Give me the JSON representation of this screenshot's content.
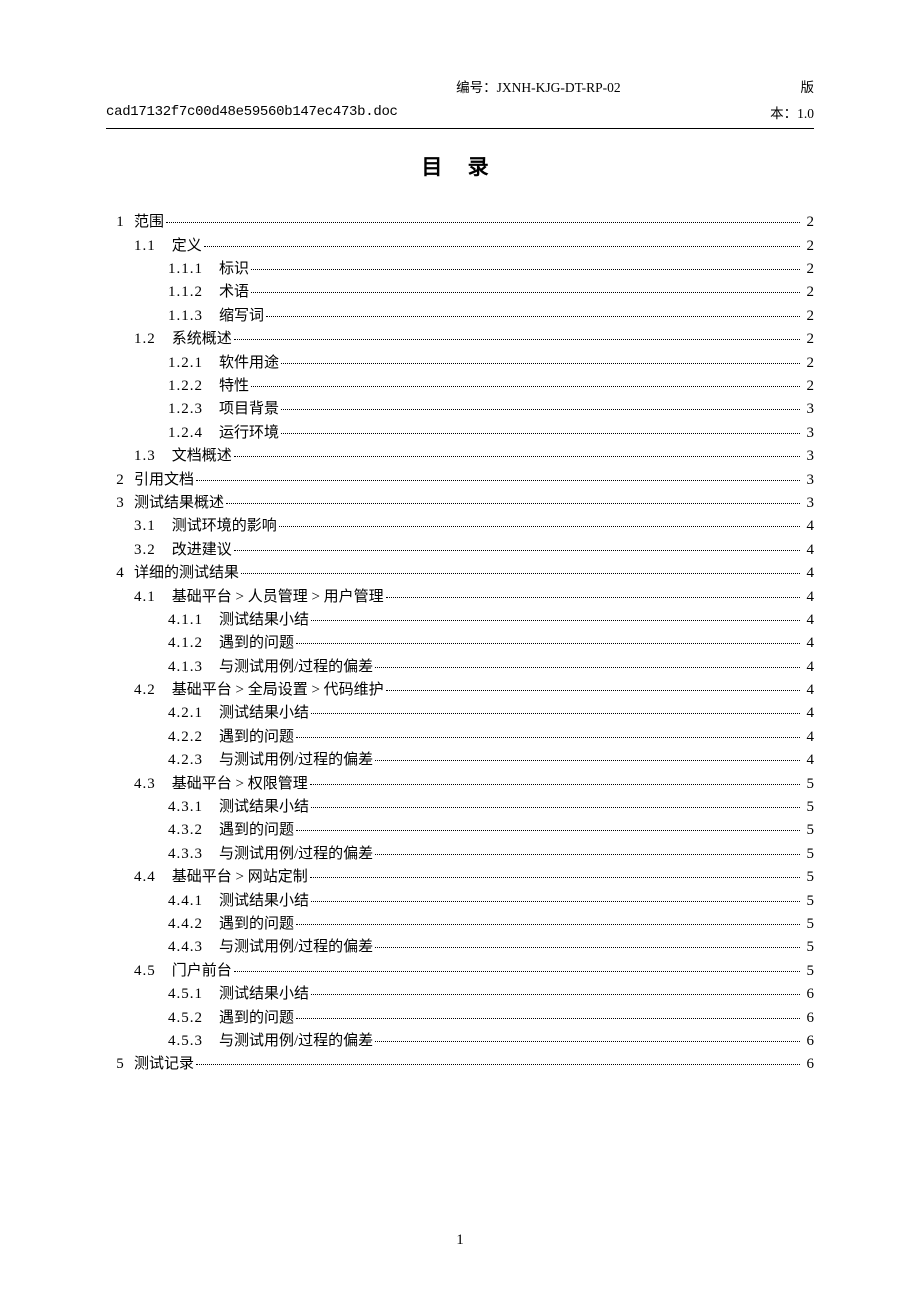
{
  "header": {
    "left": "cad17132f7c00d48e59560b147ec473b.doc",
    "right_line1_label": "编号：",
    "right_line1_value": "JXNH-KJG-DT-RP-02",
    "right_line2_label": "版",
    "right_line2_prefix": "本：",
    "right_line2_value": "1.0"
  },
  "title": "目 录",
  "toc": {
    "entries": [
      {
        "level": 0,
        "num": "1",
        "text": "范围",
        "page": "2"
      },
      {
        "level": 1,
        "num": "1.1",
        "text": "定义",
        "page": "2"
      },
      {
        "level": 2,
        "num": "1.1.1",
        "text": "标识",
        "page": "2"
      },
      {
        "level": 2,
        "num": "1.1.2",
        "text": "术语",
        "page": "2"
      },
      {
        "level": 2,
        "num": "1.1.3",
        "text": "缩写词",
        "page": "2"
      },
      {
        "level": 1,
        "num": "1.2",
        "text": "系统概述",
        "page": "2"
      },
      {
        "level": 2,
        "num": "1.2.1",
        "text": "软件用途",
        "page": "2"
      },
      {
        "level": 2,
        "num": "1.2.2",
        "text": "特性",
        "page": "2"
      },
      {
        "level": 2,
        "num": "1.2.3",
        "text": "项目背景",
        "page": "3"
      },
      {
        "level": 2,
        "num": "1.2.4",
        "text": "运行环境",
        "page": "3"
      },
      {
        "level": 1,
        "num": "1.3",
        "text": "文档概述",
        "page": "3"
      },
      {
        "level": 0,
        "num": "2",
        "text": "引用文档",
        "page": "3"
      },
      {
        "level": 0,
        "num": "3",
        "text": "测试结果概述",
        "page": "3"
      },
      {
        "level": 1,
        "num": "3.1",
        "text": "测试环境的影响",
        "page": "4"
      },
      {
        "level": 1,
        "num": "3.2",
        "text": "改进建议",
        "page": "4"
      },
      {
        "level": 0,
        "num": "4",
        "text": "详细的测试结果",
        "page": "4"
      },
      {
        "level": 1,
        "num": "4.1",
        "text": "基础平台 > 人员管理 > 用户管理",
        "page": "4"
      },
      {
        "level": 2,
        "num": "4.1.1",
        "text": "测试结果小结",
        "page": "4"
      },
      {
        "level": 2,
        "num": "4.1.2",
        "text": "遇到的问题",
        "page": "4"
      },
      {
        "level": 2,
        "num": "4.1.3",
        "text": "与测试用例/过程的偏差",
        "page": "4"
      },
      {
        "level": 1,
        "num": "4.2",
        "text": "基础平台 > 全局设置 > 代码维护",
        "page": "4"
      },
      {
        "level": 2,
        "num": "4.2.1",
        "text": "测试结果小结",
        "page": "4"
      },
      {
        "level": 2,
        "num": "4.2.2",
        "text": "遇到的问题",
        "page": "4"
      },
      {
        "level": 2,
        "num": "4.2.3",
        "text": "与测试用例/过程的偏差",
        "page": "4"
      },
      {
        "level": 1,
        "num": "4.3",
        "text": "基础平台 > 权限管理",
        "page": "5"
      },
      {
        "level": 2,
        "num": "4.3.1",
        "text": "测试结果小结",
        "page": "5"
      },
      {
        "level": 2,
        "num": "4.3.2",
        "text": "遇到的问题",
        "page": "5"
      },
      {
        "level": 2,
        "num": "4.3.3",
        "text": "与测试用例/过程的偏差",
        "page": "5"
      },
      {
        "level": 1,
        "num": "4.4",
        "text": "基础平台 > 网站定制",
        "page": "5"
      },
      {
        "level": 2,
        "num": "4.4.1",
        "text": "测试结果小结",
        "page": "5"
      },
      {
        "level": 2,
        "num": "4.4.2",
        "text": "遇到的问题",
        "page": "5"
      },
      {
        "level": 2,
        "num": "4.4.3",
        "text": "与测试用例/过程的偏差",
        "page": "5"
      },
      {
        "level": 1,
        "num": "4.5",
        "text": "门户前台",
        "page": "5"
      },
      {
        "level": 2,
        "num": "4.5.1",
        "text": "测试结果小结",
        "page": "6"
      },
      {
        "level": 2,
        "num": "4.5.2",
        "text": "遇到的问题",
        "page": "6"
      },
      {
        "level": 2,
        "num": "4.5.3",
        "text": "与测试用例/过程的偏差",
        "page": "6"
      },
      {
        "level": 0,
        "num": "5",
        "text": "测试记录",
        "page": "6"
      }
    ]
  },
  "footer": {
    "page_number": "1"
  }
}
